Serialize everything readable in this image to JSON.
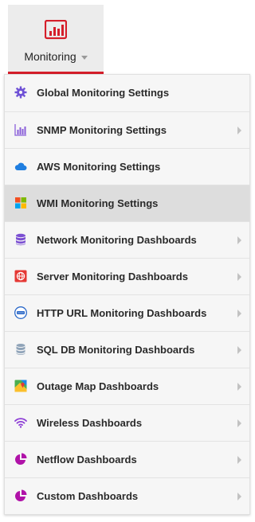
{
  "tab": {
    "label": "Monitoring",
    "icon": "bar-chart-icon",
    "accent": "#d51e2a"
  },
  "menu": {
    "items": [
      {
        "label": "Global Monitoring Settings",
        "icon": "gear-icon",
        "has_submenu": false
      },
      {
        "label": "SNMP Monitoring Settings",
        "icon": "bar-chart-icon",
        "has_submenu": true
      },
      {
        "label": "AWS Monitoring Settings",
        "icon": "cloud-icon",
        "has_submenu": false
      },
      {
        "label": "WMI Monitoring Settings",
        "icon": "windows-icon",
        "has_submenu": false,
        "selected": true
      },
      {
        "label": "Network Monitoring Dashboards",
        "icon": "database-icon",
        "has_submenu": true
      },
      {
        "label": "Server Monitoring Dashboards",
        "icon": "globe-icon",
        "has_submenu": true
      },
      {
        "label": "HTTP URL Monitoring Dashboards",
        "icon": "http-icon",
        "has_submenu": true
      },
      {
        "label": "SQL DB Monitoring Dashboards",
        "icon": "database-gray-icon",
        "has_submenu": true
      },
      {
        "label": "Outage Map Dashboards",
        "icon": "map-icon",
        "has_submenu": true
      },
      {
        "label": "Wireless Dashboards",
        "icon": "wifi-icon",
        "has_submenu": true
      },
      {
        "label": "Netflow Dashboards",
        "icon": "pie-chart-icon",
        "has_submenu": true
      },
      {
        "label": "Custom Dashboards",
        "icon": "pie-chart-icon",
        "has_submenu": true
      }
    ]
  }
}
